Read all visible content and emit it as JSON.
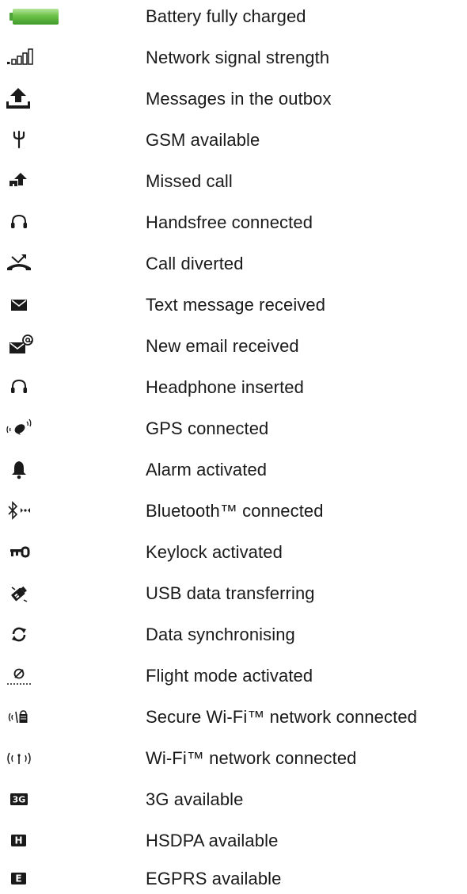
{
  "status_icons": [
    {
      "icon": "battery-full-icon",
      "label": "Battery fully charged"
    },
    {
      "icon": "signal-strength-icon",
      "label": "Network signal strength"
    },
    {
      "icon": "outbox-icon",
      "label": "Messages in the outbox"
    },
    {
      "icon": "gsm-antenna-icon",
      "label": "GSM available"
    },
    {
      "icon": "missed-call-icon",
      "label": "Missed call"
    },
    {
      "icon": "handsfree-icon",
      "label": "Handsfree connected"
    },
    {
      "icon": "call-divert-icon",
      "label": "Call diverted"
    },
    {
      "icon": "envelope-icon",
      "label": "Text message received"
    },
    {
      "icon": "email-icon",
      "label": "New email received"
    },
    {
      "icon": "headphone-icon",
      "label": "Headphone inserted"
    },
    {
      "icon": "gps-icon",
      "label": "GPS connected"
    },
    {
      "icon": "alarm-bell-icon",
      "label": "Alarm activated"
    },
    {
      "icon": "bluetooth-icon",
      "label": "Bluetooth™ connected"
    },
    {
      "icon": "key-icon",
      "label": "Keylock activated"
    },
    {
      "icon": "usb-transfer-icon",
      "label": "USB data transferring"
    },
    {
      "icon": "sync-icon",
      "label": "Data synchronising"
    },
    {
      "icon": "flight-mode-icon",
      "label": "Flight mode activated"
    },
    {
      "icon": "secure-wifi-icon",
      "label": "Secure Wi-Fi™ network connected"
    },
    {
      "icon": "wifi-icon",
      "label": "Wi-Fi™ network connected"
    },
    {
      "icon": "3g-badge-icon",
      "label": "3G available"
    },
    {
      "icon": "hsdpa-badge-icon",
      "label": "HSDPA available"
    },
    {
      "icon": "egprs-badge-icon",
      "label": "EGPRS available"
    }
  ],
  "colors": {
    "text": "#1a1a1a",
    "icon": "#1a1a1a",
    "battery_green": "#6cc24a"
  }
}
